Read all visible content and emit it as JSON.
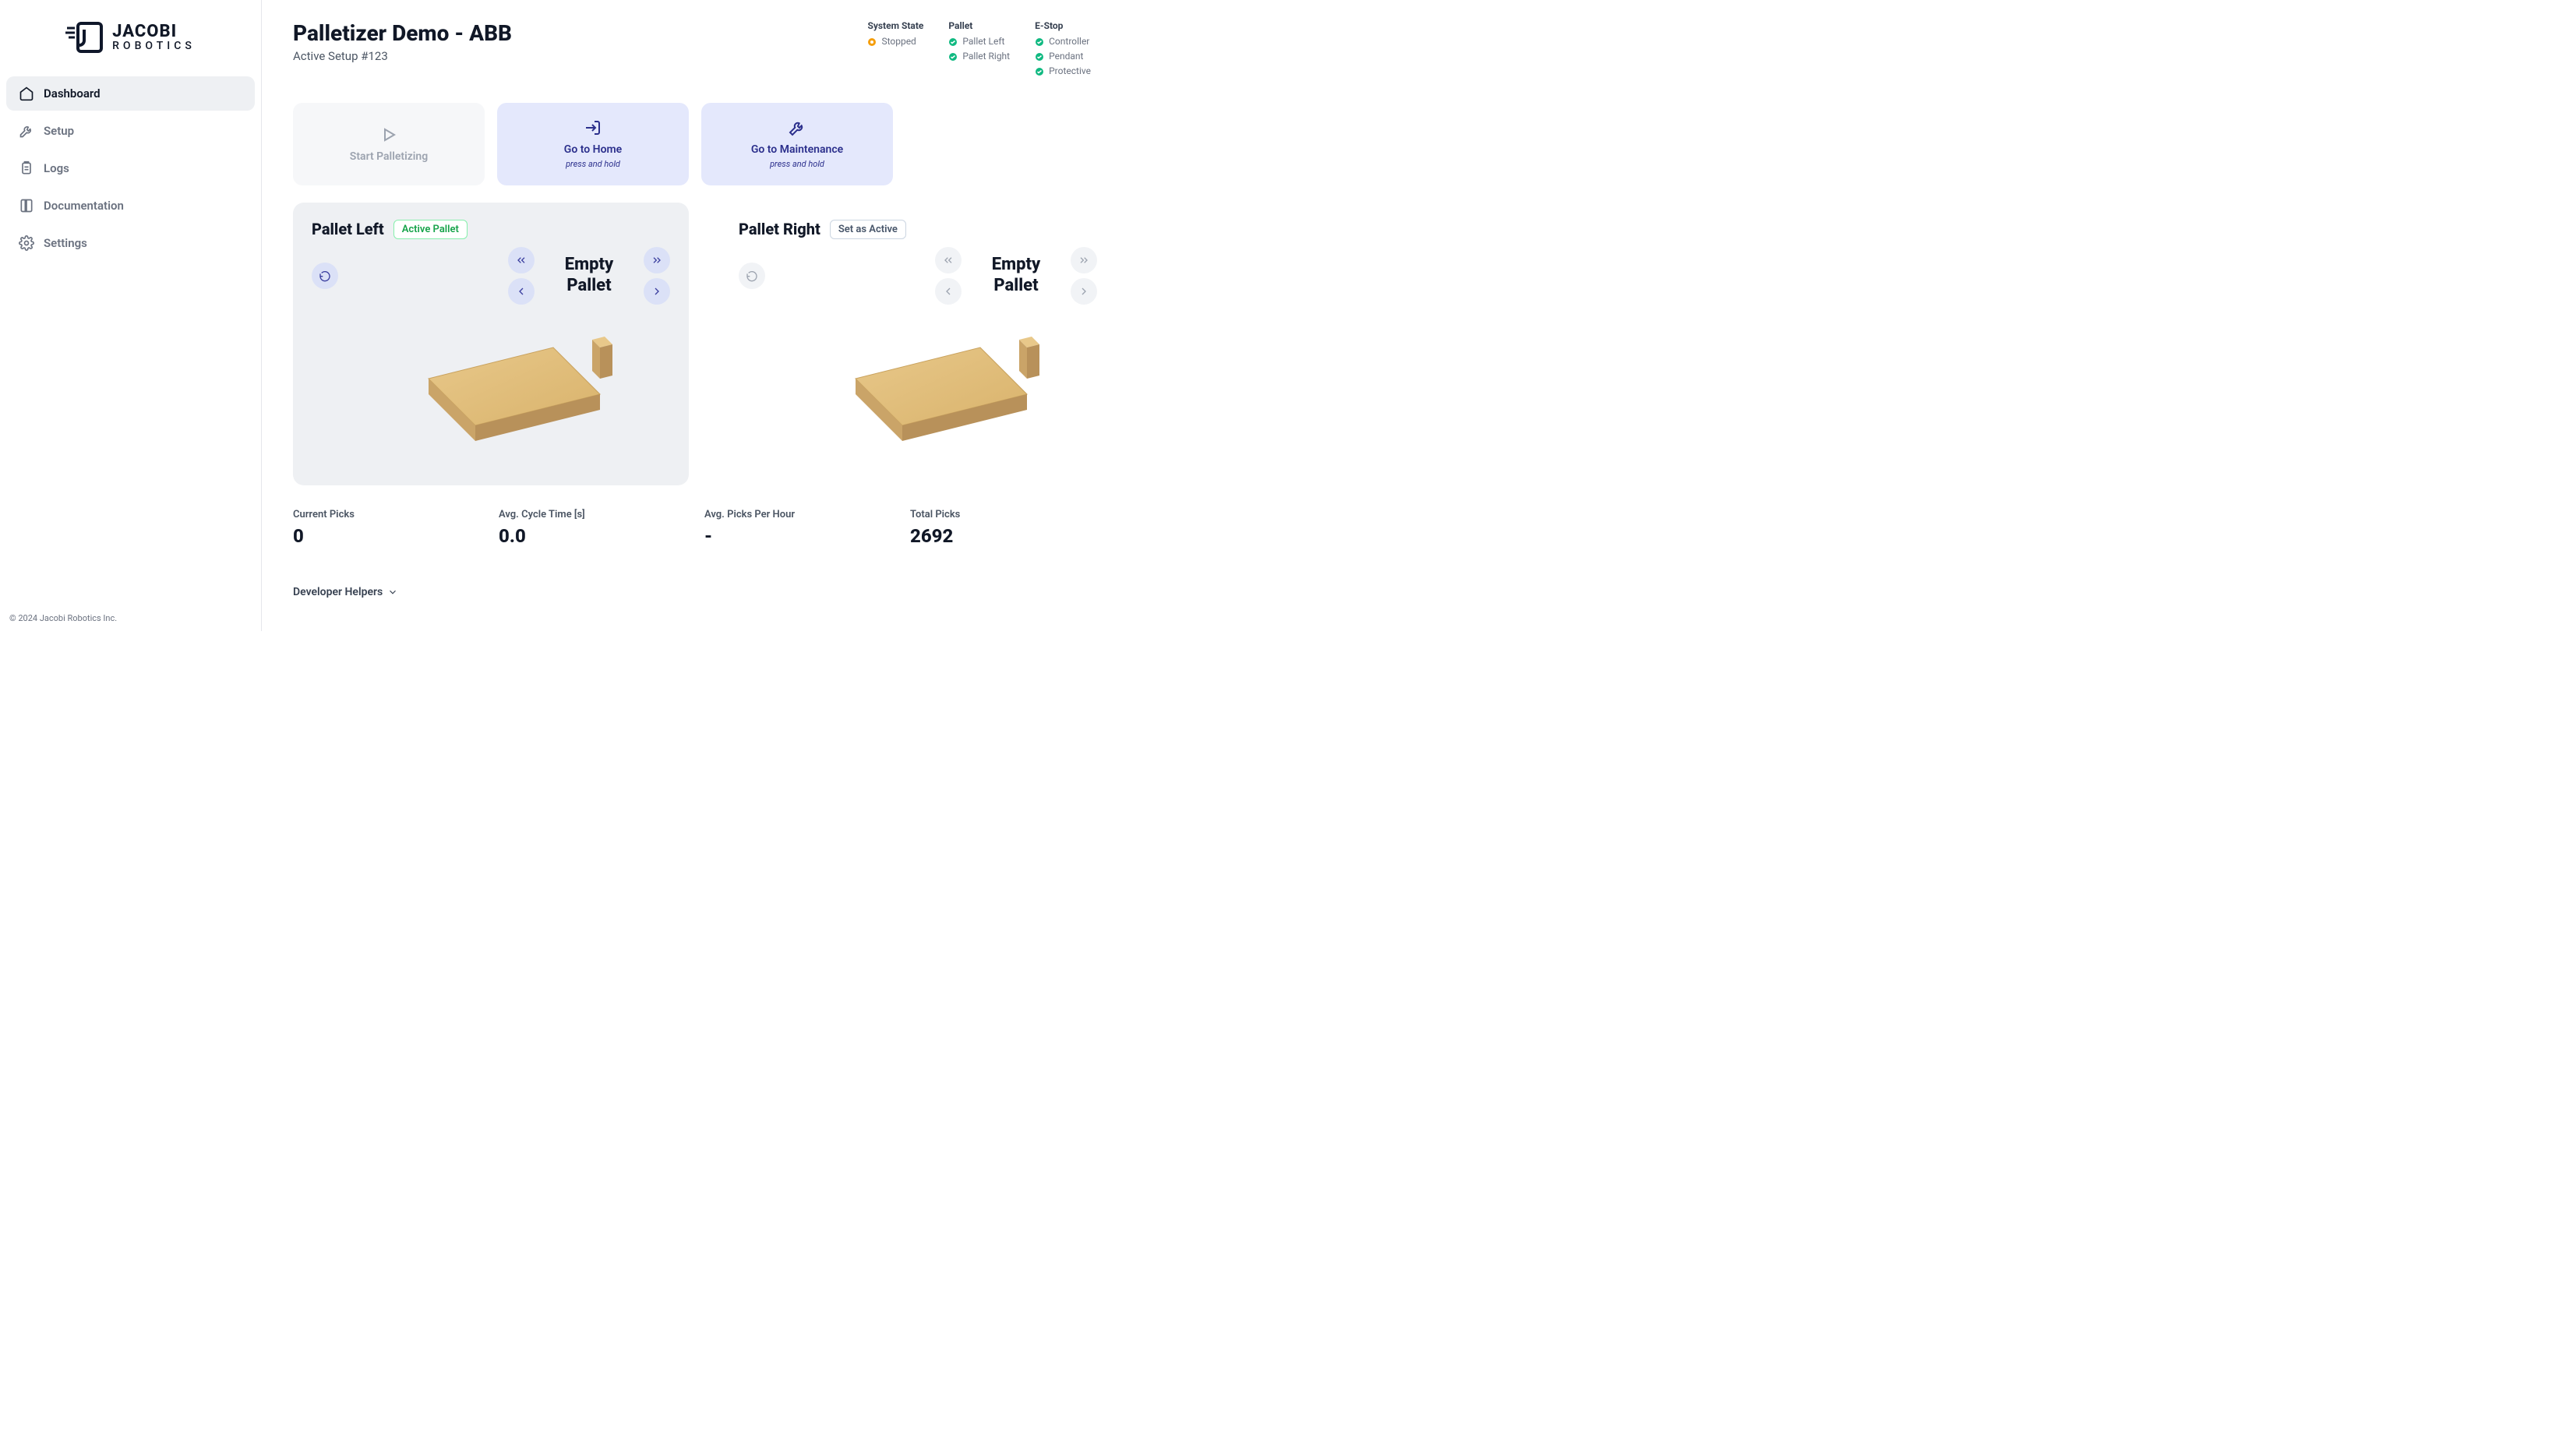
{
  "logo": {
    "line1": "JACOBI",
    "line2": "ROBOTICS"
  },
  "nav": [
    {
      "label": "Dashboard",
      "icon": "home",
      "active": true
    },
    {
      "label": "Setup",
      "icon": "tools",
      "active": false
    },
    {
      "label": "Logs",
      "icon": "clipboard",
      "active": false
    },
    {
      "label": "Documentation",
      "icon": "book",
      "active": false
    },
    {
      "label": "Settings",
      "icon": "gear",
      "active": false
    }
  ],
  "copyright": "© 2024 Jacobi Robotics Inc.",
  "header": {
    "title": "Palletizer Demo - ABB",
    "subtitle": "Active Setup #123"
  },
  "status": {
    "system": {
      "header": "System State",
      "items": [
        {
          "label": "Stopped",
          "color": "orange"
        }
      ]
    },
    "pallet": {
      "header": "Pallet",
      "items": [
        {
          "label": "Pallet Left",
          "color": "green"
        },
        {
          "label": "Pallet Right",
          "color": "green"
        }
      ]
    },
    "estop": {
      "header": "E-Stop",
      "items": [
        {
          "label": "Controller",
          "color": "green"
        },
        {
          "label": "Pendant",
          "color": "green"
        },
        {
          "label": "Protective",
          "color": "green"
        }
      ]
    }
  },
  "actions": {
    "start": {
      "label": "Start Palletizing"
    },
    "home": {
      "label": "Go to Home",
      "hint": "press and hold"
    },
    "maint": {
      "label": "Go to Maintenance",
      "hint": "press and hold"
    }
  },
  "pallets": {
    "left": {
      "title": "Pallet Left",
      "badge": "Active Pallet",
      "status": "Empty Pallet"
    },
    "right": {
      "title": "Pallet Right",
      "badge": "Set as Active",
      "status": "Empty Pallet"
    }
  },
  "stats": [
    {
      "label": "Current Picks",
      "value": "0"
    },
    {
      "label": "Avg. Cycle Time [s]",
      "value": "0.0"
    },
    {
      "label": "Avg. Picks Per Hour",
      "value": "-"
    },
    {
      "label": "Total Picks",
      "value": "2692"
    }
  ],
  "dev_helpers": "Developer Helpers"
}
